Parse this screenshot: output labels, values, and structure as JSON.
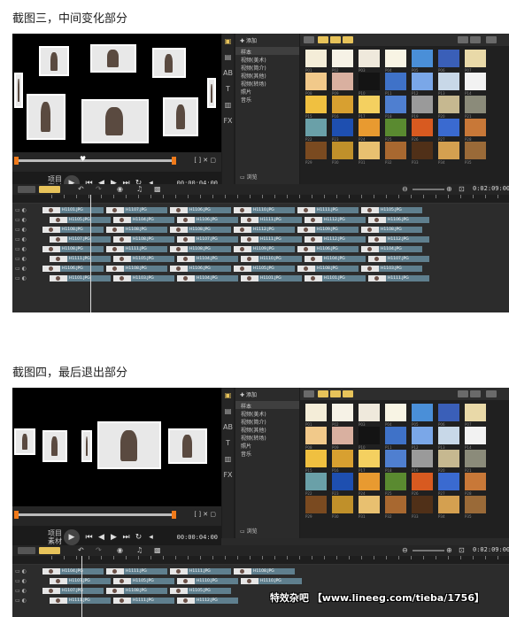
{
  "captions": {
    "one": "截图三，中间变化部分",
    "two": "截图四，最后退出部分"
  },
  "player": {
    "mode_label": "项目",
    "mode_sub": "素材",
    "timecode": "00:00:04:00"
  },
  "library": {
    "add_label": "添加",
    "items": [
      "样本",
      "视频(美术)",
      "视频(简介)",
      "视频(其他)",
      "视频(转场)",
      "照片",
      "音乐"
    ],
    "browse_label": "浏览"
  },
  "timeline": {
    "time_end": "0:02:09:00"
  },
  "clip_names_1": [
    [
      "H1101.JPG",
      "H1107.JPG",
      "H1106.JPG",
      "H1110.JPG",
      "H1111.JPG",
      "H1105.JPG"
    ],
    [
      "H1105.JPG",
      "H1104.JPG",
      "H1106.JPG",
      "H1111.JPG",
      "H1112.JPG",
      "H1106.JPG"
    ],
    [
      "H1108.JPG",
      "H1108.JPG",
      "H1108.JPG",
      "H1112.JPG",
      "H1109.JPG",
      "H1108.JPG"
    ],
    [
      "H1107.JPG",
      "H1108.JPG",
      "H1107.JPG",
      "H1111.JPG",
      "H1112.JPG",
      "H1112.JPG"
    ],
    [
      "H1108.JPG",
      "H1111.JPG",
      "H1108.JPG",
      "H1109.JPG",
      "H1106.JPG",
      "H1104.JPG"
    ],
    [
      "H1111.JPG",
      "H1105.JPG",
      "H1104.JPG",
      "H1110.JPG",
      "H1104.JPG",
      "H1107.JPG"
    ],
    [
      "H1106.JPG",
      "H1108.JPG",
      "H1106.JPG",
      "H1105.JPG",
      "H1108.JPG",
      "H1103.JPG"
    ],
    [
      "H1101.JPG",
      "H1103.JPG",
      "H1104.JPG",
      "H1101.JPG",
      "H1101.JPG",
      "H1111.JPG"
    ]
  ],
  "clip_names_2": [
    [
      "H1104.JPG",
      "H1111.JPG",
      "H1111.JPG",
      "H1108.JPG"
    ],
    [
      "H1107.JPG",
      "H1105.JPG",
      "H1110.JPG",
      "H1110.JPG"
    ],
    [
      "H1107.JPG",
      "H1108.JPG",
      "H1105.JPG"
    ],
    [
      "H1111.JPG",
      "H1111.JPG",
      "H1112.JPG"
    ]
  ],
  "thumb_labels": [
    "P01",
    "P02",
    "P03",
    "P04",
    "P05",
    "P06",
    "P07",
    "P08",
    "P09",
    "P10",
    "P11",
    "P12",
    "P13",
    "P14",
    "P15",
    "P16",
    "P17",
    "P18",
    "P19",
    "P20",
    "P21",
    "P22",
    "P23",
    "P24",
    "P25",
    "P26",
    "P27",
    "P28",
    "P29",
    "P30",
    "P31",
    "P32",
    "P33",
    "P34",
    "P35"
  ],
  "watermark": "特效杂吧 【www.lineeg.com/tieba/1756】",
  "colors": {
    "accent": "#e7c35a",
    "clip": "#5f7f8e",
    "marker": "#f07a1a"
  }
}
